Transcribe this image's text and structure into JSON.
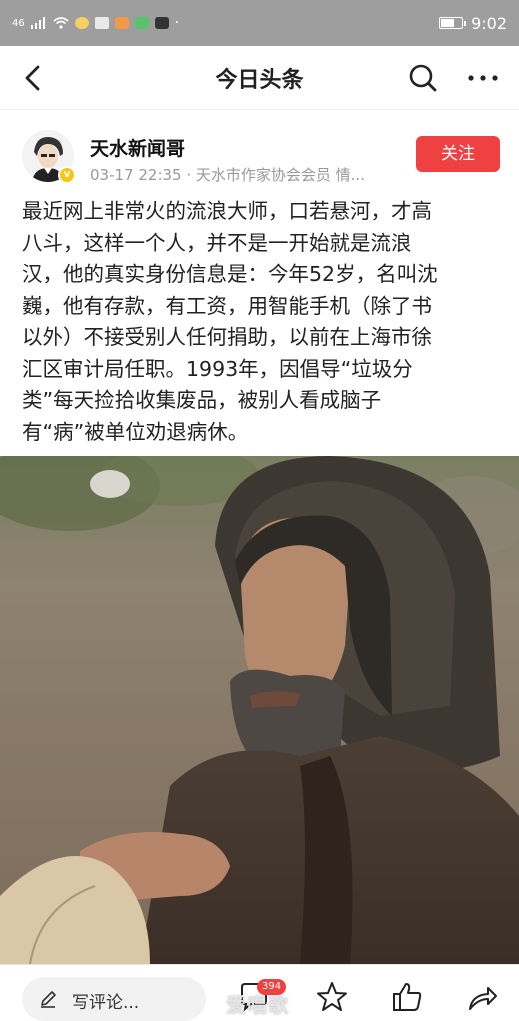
{
  "status_bar": {
    "signal": "46",
    "time": "9:02"
  },
  "nav": {
    "title": "今日头条",
    "back_icon": "chevron-left-icon",
    "search_icon": "search-icon",
    "more_icon": "more-dots-icon"
  },
  "author": {
    "name": "天水新闻哥",
    "meta": "03-17 22:35 · 天水市作家协会会员 情...",
    "follow_label": "关注",
    "verified_icon": "verified-v-icon"
  },
  "article": {
    "lines": [
      "最近网上非常火的流浪大师，口若悬河，才高",
      "八斗，这样一个人，并不是一开始就是流浪",
      "汉，他的真实身份信息是：今年52岁，名叫沈",
      "巍，他有存款，有工资，用智能手机（除了书",
      "以外）不接受别人任何捐助，以前在上海市徐",
      "汇区审计局任职。1993年，因倡导“垃圾分",
      "类”每天捡拾收集废品，被别人看成脑子",
      "有“病”被单位劝退病休。"
    ]
  },
  "bottom_bar": {
    "comment_placeholder": "写评论...",
    "comment_count": "394",
    "watermark": "爱唱歌",
    "icons": [
      "pencil-icon",
      "comment-bubble-icon",
      "star-icon",
      "thumbs-up-icon",
      "share-arrow-icon"
    ]
  },
  "colors": {
    "accent": "#f04142",
    "status_bar": "#9e9e9e",
    "meta_text": "#999999"
  }
}
